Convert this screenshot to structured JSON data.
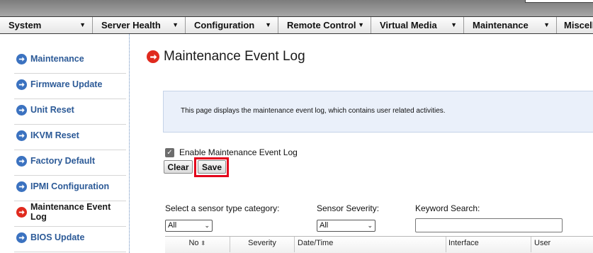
{
  "nav": {
    "items": [
      "System",
      "Server Health",
      "Configuration",
      "Remote Control",
      "Virtual Media",
      "Maintenance",
      "Miscell"
    ]
  },
  "sidebar": {
    "items": [
      "Maintenance",
      "Firmware Update",
      "Unit Reset",
      "IKVM Reset",
      "Factory Default",
      "IPMI Configuration",
      "Maintenance Event Log",
      "BIOS Update"
    ],
    "active_index": 6
  },
  "page": {
    "title": "Maintenance Event Log",
    "description": "This page displays the maintenance event log, which contains user related activities.",
    "enable_label": "Enable Maintenance Event Log",
    "enable_checked": true,
    "clear_label": "Clear",
    "save_label": "Save"
  },
  "filters": {
    "category_label": "Select a sensor type category:",
    "category_value": "All",
    "severity_label": "Sensor Severity:",
    "severity_value": "All",
    "keyword_label": "Keyword Search:",
    "keyword_value": ""
  },
  "table": {
    "headers": [
      "No",
      "Severity",
      "Date/Time",
      "Interface",
      "User"
    ]
  },
  "colors": {
    "link": "#2c5a97",
    "arrow_blue": "#3b72c0",
    "arrow_red": "#e02a1e",
    "highlight": "#e3001b",
    "info_bg": "#eaf0fa"
  }
}
